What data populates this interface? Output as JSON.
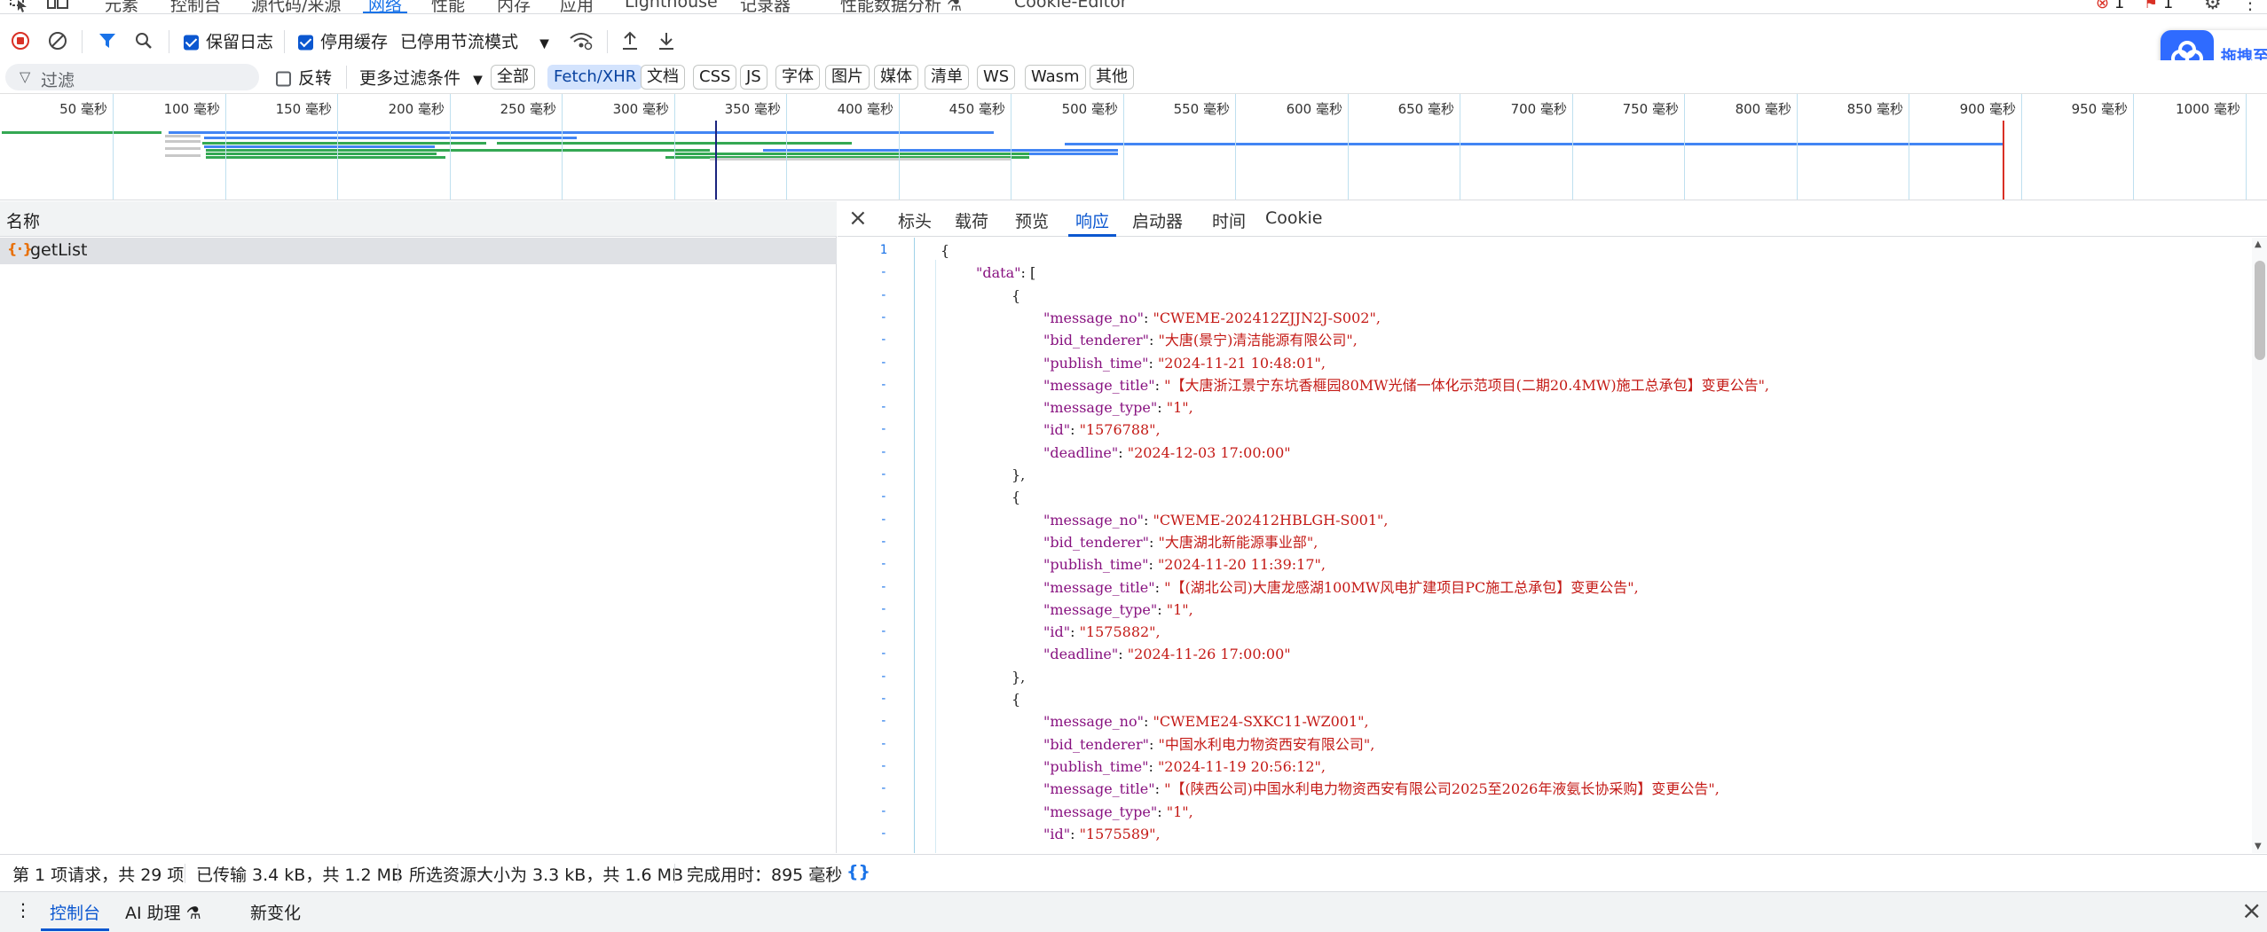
{
  "main_tabs": [
    {
      "label": "元素",
      "active": false
    },
    {
      "label": "控制台",
      "active": false
    },
    {
      "label": "源代码/来源",
      "active": false
    },
    {
      "label": "网络",
      "active": true
    },
    {
      "label": "性能",
      "active": false
    },
    {
      "label": "内存",
      "active": false
    },
    {
      "label": "应用",
      "active": false
    },
    {
      "label": "Lighthouse",
      "active": false
    },
    {
      "label": "记录器",
      "active": false
    },
    {
      "label": "性能数据分析 ⚗",
      "active": false
    },
    {
      "label": "Cookie-Editor",
      "active": false
    }
  ],
  "indicators": {
    "errors": "1",
    "issues": "1"
  },
  "toolbar": {
    "preserve_log": "保留日志",
    "disable_cache": "停用缓存",
    "throttling": "已停用节流模式"
  },
  "filter_bar": {
    "placeholder": "过滤",
    "invert": "反转",
    "more_filters": "更多过滤条件",
    "types": [
      "全部",
      "Fetch/XHR",
      "文档",
      "CSS",
      "JS",
      "字体",
      "图片",
      "媒体",
      "清单",
      "WS",
      "Wasm",
      "其他"
    ],
    "selected_type": "Fetch/XHR"
  },
  "floating_widget": {
    "label": "拖拽至"
  },
  "timeline": {
    "ticks": [
      "50 毫秒",
      "100 毫秒",
      "150 毫秒",
      "200 毫秒",
      "250 毫秒",
      "300 毫秒",
      "350 毫秒",
      "400 毫秒",
      "450 毫秒",
      "500 毫秒",
      "550 毫秒",
      "600 毫秒",
      "650 毫秒",
      "700 毫秒",
      "750 毫秒",
      "800 毫秒",
      "850 毫秒",
      "900 毫秒",
      "950 毫秒",
      "1000 毫秒"
    ],
    "colors": {
      "blue": "#4285f4",
      "green": "#34a853",
      "dom_content": "#1a237e",
      "load": "#d93025"
    }
  },
  "request_list": {
    "column_name": "名称",
    "rows": [
      {
        "name": "getList",
        "icon": "xhr-json-icon"
      }
    ]
  },
  "detail_tabs": [
    "标头",
    "载荷",
    "预览",
    "响应",
    "启动器",
    "时间",
    "Cookie"
  ],
  "detail_active": "响应",
  "response_lines": [
    {
      "n": "1",
      "indent": 0,
      "text": "{"
    },
    {
      "n": "-",
      "indent": 1,
      "key": "\"data\"",
      "text": "["
    },
    {
      "n": "-",
      "indent": 2,
      "text": "{"
    },
    {
      "n": "-",
      "indent": 3,
      "key": "\"message_no\"",
      "val": "\"CWEME-202412ZJJN2J-S002\","
    },
    {
      "n": "-",
      "indent": 3,
      "key": "\"bid_tenderer\"",
      "val": "\"大唐(景宁)清洁能源有限公司\","
    },
    {
      "n": "-",
      "indent": 3,
      "key": "\"publish_time\"",
      "val": "\"2024-11-21 10:48:01\","
    },
    {
      "n": "-",
      "indent": 3,
      "key": "\"message_title\"",
      "val": "\"【大唐浙江景宁东坑香榧园80MW光储一体化示范项目(二期20.4MW)施工总承包】变更公告\","
    },
    {
      "n": "-",
      "indent": 3,
      "key": "\"message_type\"",
      "val": "\"1\","
    },
    {
      "n": "-",
      "indent": 3,
      "key": "\"id\"",
      "val": "\"1576788\","
    },
    {
      "n": "-",
      "indent": 3,
      "key": "\"deadline\"",
      "val": "\"2024-12-03 17:00:00\""
    },
    {
      "n": "-",
      "indent": 2,
      "text": "},"
    },
    {
      "n": "-",
      "indent": 2,
      "text": "{"
    },
    {
      "n": "-",
      "indent": 3,
      "key": "\"message_no\"",
      "val": "\"CWEME-202412HBLGH-S001\","
    },
    {
      "n": "-",
      "indent": 3,
      "key": "\"bid_tenderer\"",
      "val": "\"大唐湖北新能源事业部\","
    },
    {
      "n": "-",
      "indent": 3,
      "key": "\"publish_time\"",
      "val": "\"2024-11-20 11:39:17\","
    },
    {
      "n": "-",
      "indent": 3,
      "key": "\"message_title\"",
      "val": "\"【(湖北公司)大唐龙感湖100MW风电扩建项目PC施工总承包】变更公告\","
    },
    {
      "n": "-",
      "indent": 3,
      "key": "\"message_type\"",
      "val": "\"1\","
    },
    {
      "n": "-",
      "indent": 3,
      "key": "\"id\"",
      "val": "\"1575882\","
    },
    {
      "n": "-",
      "indent": 3,
      "key": "\"deadline\"",
      "val": "\"2024-11-26 17:00:00\""
    },
    {
      "n": "-",
      "indent": 2,
      "text": "},"
    },
    {
      "n": "-",
      "indent": 2,
      "text": "{"
    },
    {
      "n": "-",
      "indent": 3,
      "key": "\"message_no\"",
      "val": "\"CWEME24-SXKC11-WZ001\","
    },
    {
      "n": "-",
      "indent": 3,
      "key": "\"bid_tenderer\"",
      "val": "\"中国水利电力物资西安有限公司\","
    },
    {
      "n": "-",
      "indent": 3,
      "key": "\"publish_time\"",
      "val": "\"2024-11-19 20:56:12\","
    },
    {
      "n": "-",
      "indent": 3,
      "key": "\"message_title\"",
      "val": "\"【(陕西公司)中国水利电力物资西安有限公司2025至2026年液氨长协采购】变更公告\","
    },
    {
      "n": "-",
      "indent": 3,
      "key": "\"message_type\"",
      "val": "\"1\","
    },
    {
      "n": "-",
      "indent": 3,
      "key": "\"id\"",
      "val": "\"1575589\","
    }
  ],
  "status_bar": {
    "requests": "第 1 项请求，共 29 项",
    "transferred": "已传输 3.4 kB，共 1.2 MB",
    "resources": "所选资源大小为 3.3 kB，共 1.6 MB",
    "finish": "完成用时：895 毫秒",
    "pretty_print": "{}"
  },
  "drawer": {
    "tabs": [
      "控制台",
      "AI 助理 ⚗",
      "新变化"
    ],
    "active": "控制台"
  }
}
